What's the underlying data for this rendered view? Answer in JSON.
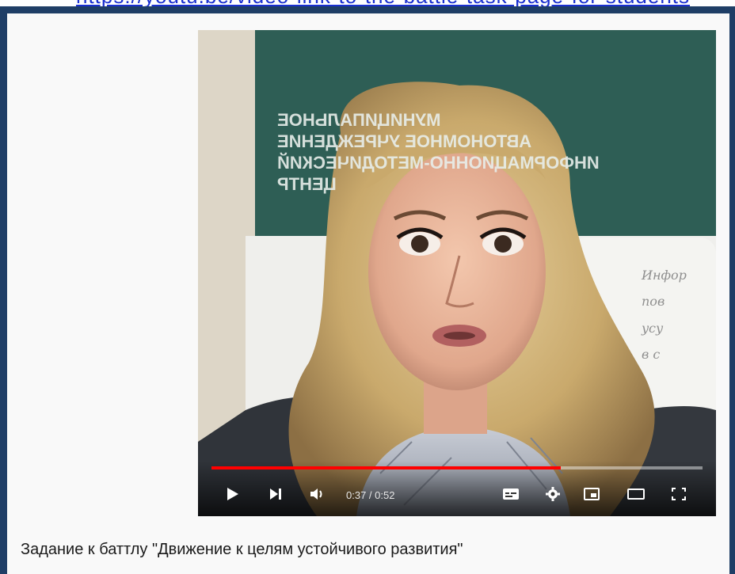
{
  "header": {
    "link_text": "https://youtu.be/video-link-to-the-battle-task-page-for-students"
  },
  "video": {
    "banner_lines": [
      "МУНИЦИПАЛЬНОЕ",
      "АВТОНОМНОЕ УЧРЕЖДЕНИЕ",
      "ИНФОРМАЦИОННО-МЕТОДИЧЕСКИЙ",
      "ЦЕНТР"
    ],
    "time_current": "0:37",
    "time_separator": " / ",
    "time_total": "0:52",
    "progress": 0.712,
    "accent_color": "#ff0000"
  },
  "controls": {
    "icons": [
      "play-icon",
      "next-icon",
      "volume-icon",
      "subtitles-icon",
      "settings-icon",
      "miniplayer-icon",
      "theater-icon",
      "fullscreen-icon"
    ]
  },
  "caption": {
    "text": "Задание к баттлу \"Движение к целям устойчивого развития\""
  }
}
